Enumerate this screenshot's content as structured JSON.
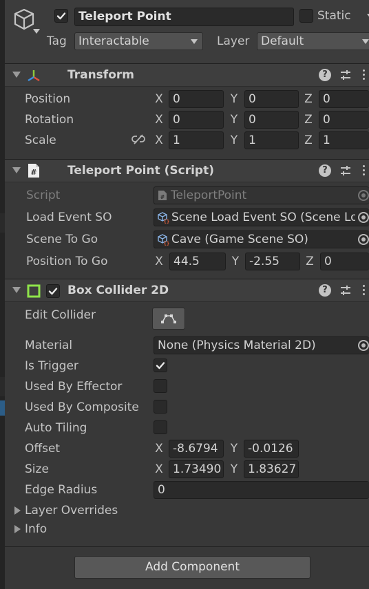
{
  "object": {
    "name": "Teleport Point",
    "active": true,
    "static_label": "Static",
    "tag_label": "Tag",
    "tag_value": "Interactable",
    "layer_label": "Layer",
    "layer_value": "Default"
  },
  "transform": {
    "title": "Transform",
    "rows": [
      {
        "label": "Position",
        "x": "0",
        "y": "0",
        "z": "0"
      },
      {
        "label": "Rotation",
        "x": "0",
        "y": "0",
        "z": "0"
      },
      {
        "label": "Scale",
        "x": "1",
        "y": "1",
        "z": "1"
      }
    ],
    "axis": {
      "x": "X",
      "y": "Y",
      "z": "Z"
    }
  },
  "script_component": {
    "title": "Teleport Point (Script)",
    "script_label": "Script",
    "script_value": "TeleportPoint",
    "load_event_label": "Load Event SO",
    "load_event_value": "Scene Load Event SO (Scene Lo",
    "scene_label": "Scene To Go",
    "scene_value": "Cave (Game Scene SO)",
    "position_label": "Position To Go",
    "position": {
      "x": "44.5",
      "y": "-2.55",
      "z": "0"
    }
  },
  "box_collider": {
    "title": "Box Collider 2D",
    "enabled": true,
    "edit_collider_label": "Edit Collider",
    "material_label": "Material",
    "material_value": "None (Physics Material 2D)",
    "is_trigger_label": "Is Trigger",
    "is_trigger": true,
    "used_by_effector_label": "Used By Effector",
    "used_by_composite_label": "Used By Composite",
    "auto_tiling_label": "Auto Tiling",
    "offset_label": "Offset",
    "offset": {
      "x": "-8.6794",
      "y": "-0.0126"
    },
    "size_label": "Size",
    "size": {
      "x": "1.73490",
      "y": "1.83627"
    },
    "edge_radius_label": "Edge Radius",
    "edge_radius_value": "0",
    "layer_overrides_label": "Layer Overrides",
    "info_label": "Info"
  },
  "add_component_label": "Add Component",
  "colors": {
    "background": "#383838",
    "field": "#2a2a2a",
    "header": "#3e3e3e",
    "collider_green": "#8fe44a"
  }
}
